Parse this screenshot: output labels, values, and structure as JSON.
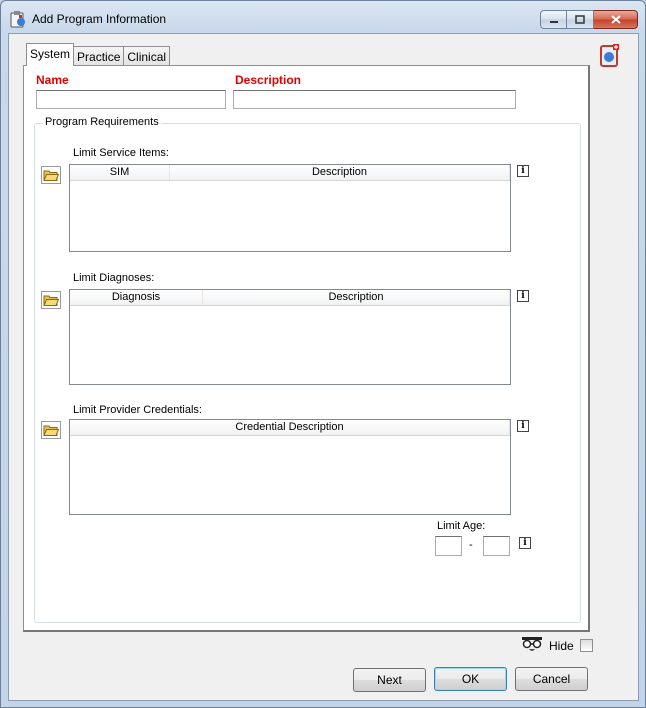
{
  "window": {
    "title": "Add Program Information"
  },
  "tabs": [
    {
      "label": "System",
      "active": true
    },
    {
      "label": "Practice",
      "active": false
    },
    {
      "label": "Clinical",
      "active": false
    }
  ],
  "fields": {
    "name_label": "Name",
    "name_value": "",
    "description_label": "Description",
    "description_value": ""
  },
  "program_requirements": {
    "title": "Program Requirements",
    "service_items": {
      "label": "Limit Service Items:",
      "columns": [
        "SIM",
        "Description"
      ],
      "rows": []
    },
    "diagnoses": {
      "label": "Limit Diagnoses:",
      "columns": [
        "Diagnosis",
        "Description"
      ],
      "rows": []
    },
    "credentials": {
      "label": "Limit Provider Credentials:",
      "columns": [
        "Credential Description"
      ],
      "rows": []
    },
    "age": {
      "label": "Limit Age:",
      "separator": "-",
      "min": "",
      "max": ""
    }
  },
  "footer": {
    "hide_label": "Hide",
    "hide_checked": false,
    "next_label": "Next",
    "ok_label": "OK",
    "cancel_label": "Cancel"
  },
  "icons": {
    "title": "app-clipboard-icon",
    "help": "help-book-icon",
    "folder": "open-folder-icon",
    "info": "info-icon",
    "hide": "disguise-glasses-icon"
  },
  "colors": {
    "required_label": "#e00000",
    "window_frame": "#c4d4e8"
  }
}
